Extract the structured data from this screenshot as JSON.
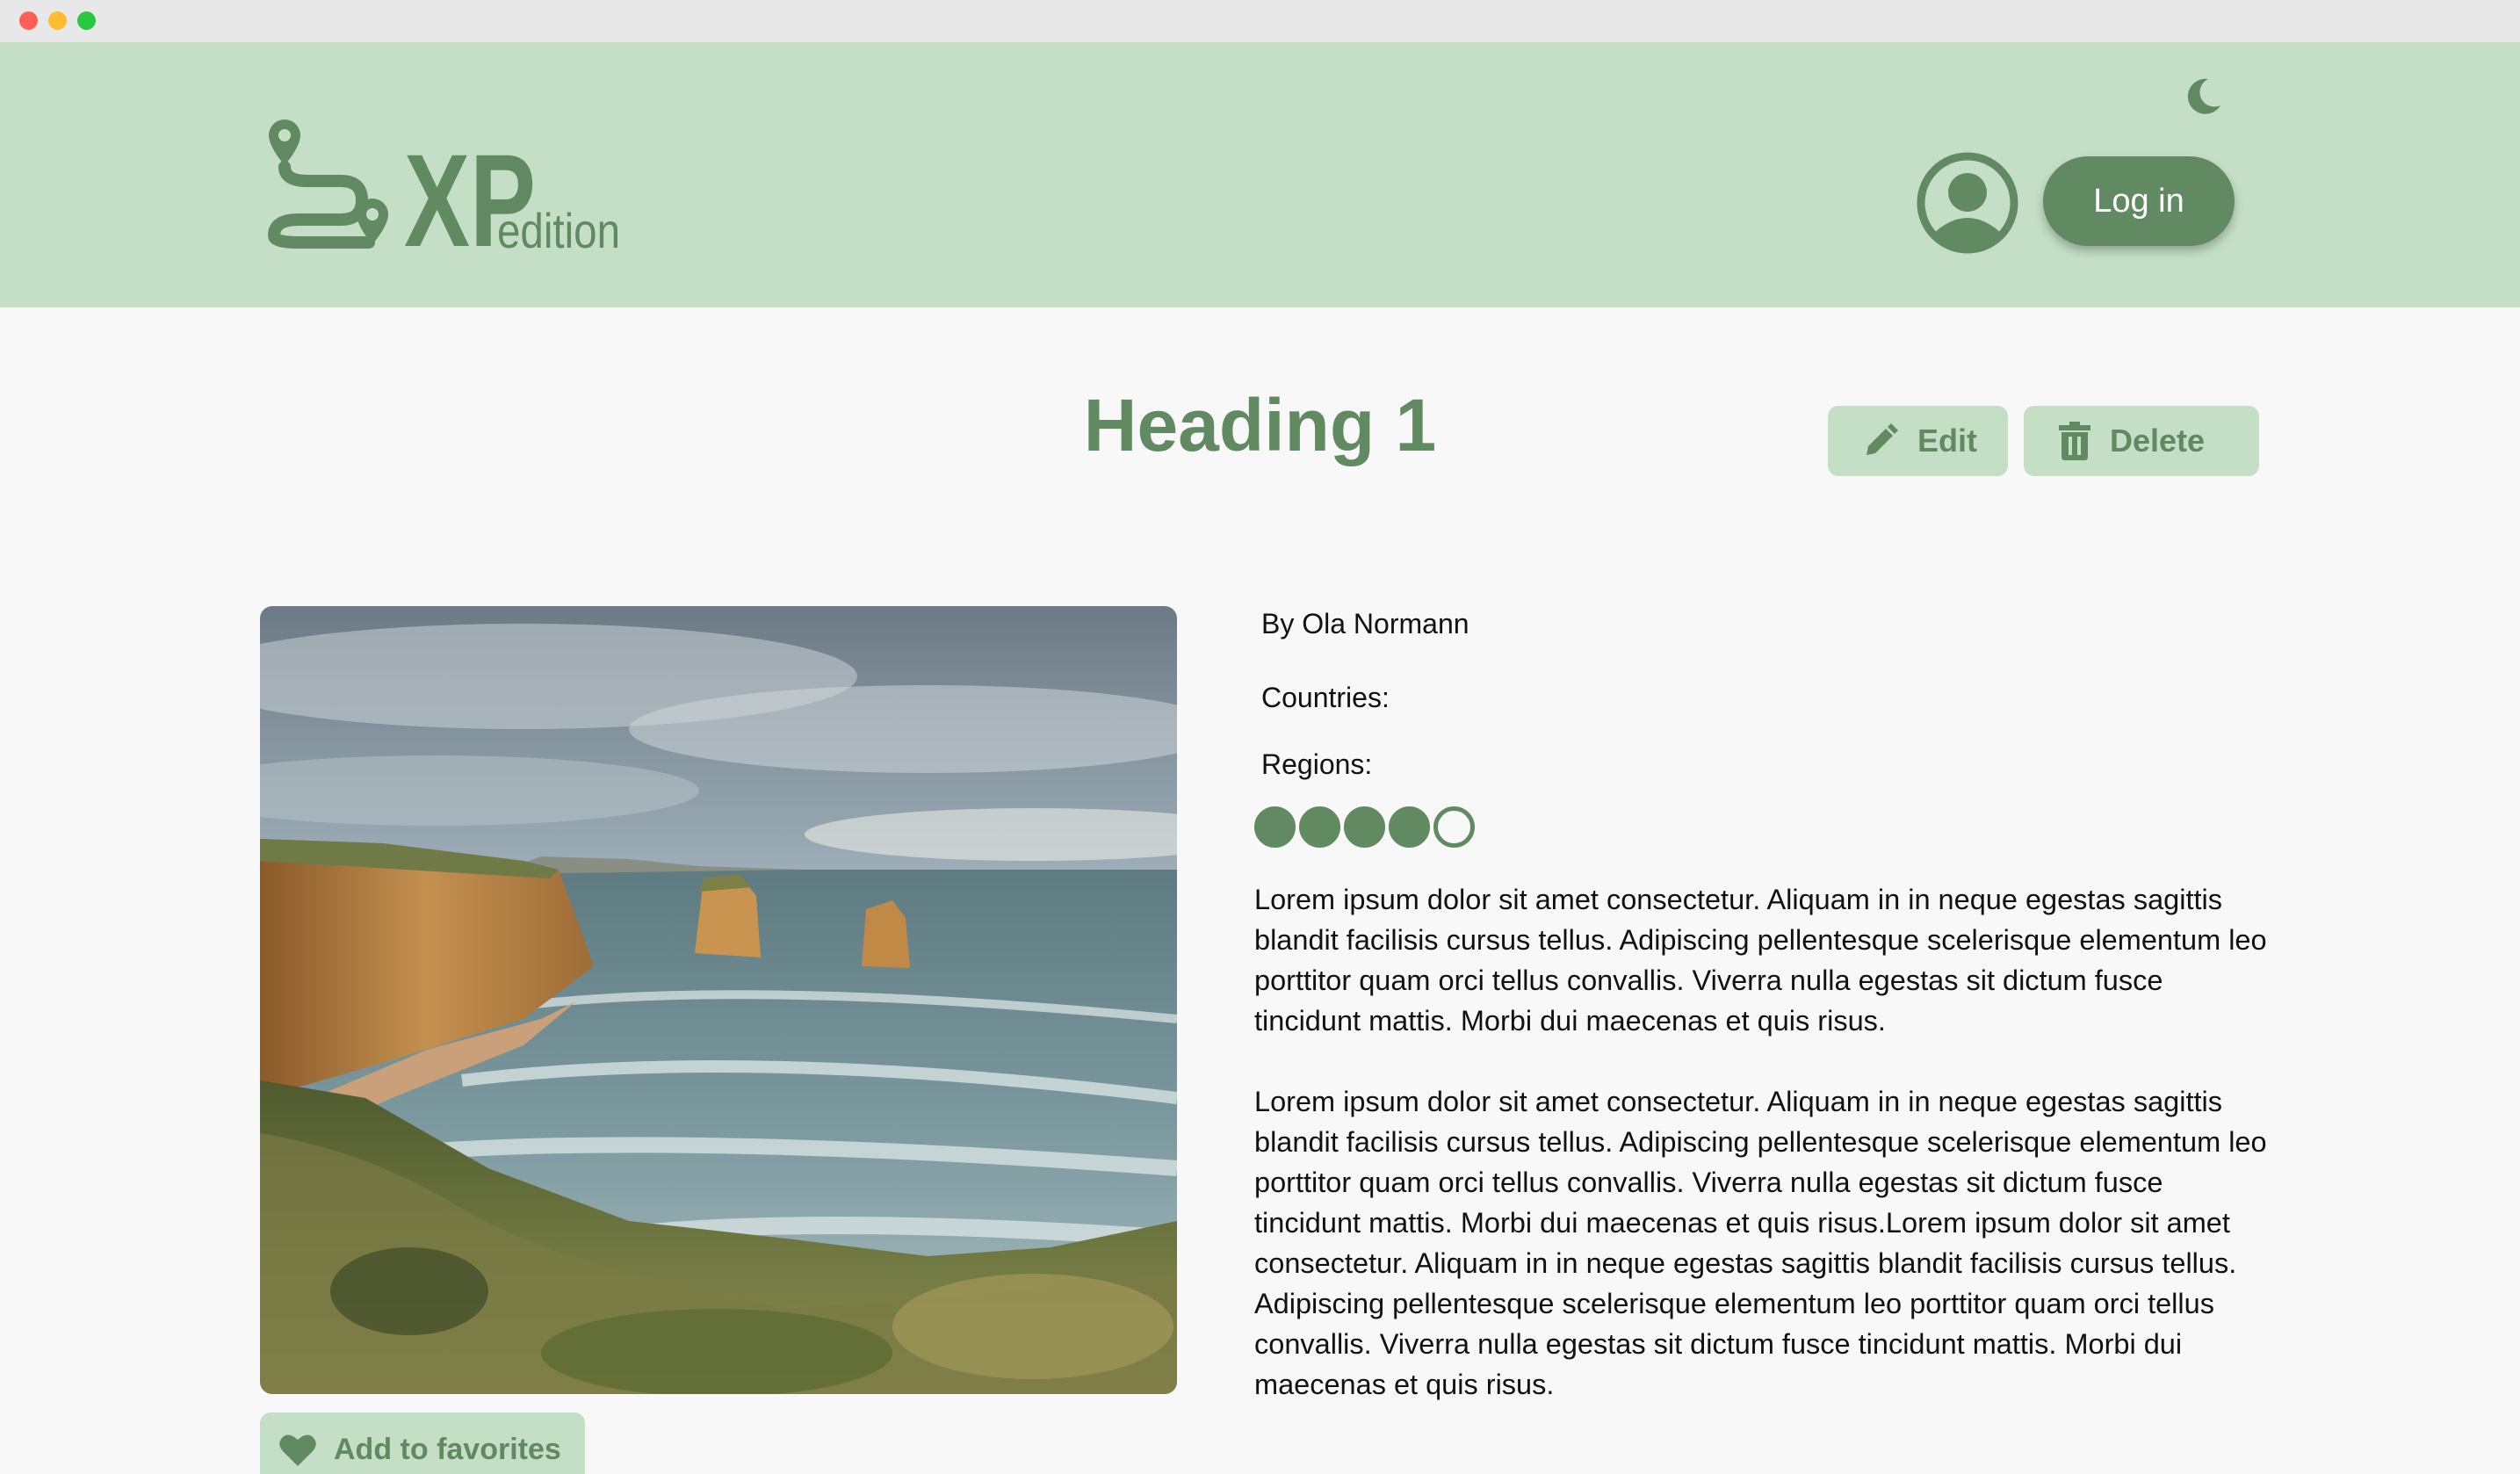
{
  "window": {
    "controls": [
      "close",
      "minimize",
      "zoom"
    ]
  },
  "header": {
    "logo": {
      "main": "XP",
      "sub": "edition"
    },
    "theme_toggle_icon": "moon-icon",
    "profile_icon": "user-circle-icon",
    "login_label": "Log in"
  },
  "page": {
    "title": "Heading 1",
    "edit_label": "Edit",
    "delete_label": "Delete"
  },
  "trip": {
    "author": "By Ola Normann",
    "countries_label": "Countries:",
    "regions_label": "Regions:",
    "rating": {
      "value": 4,
      "max": 5
    },
    "paragraphs": [
      "Lorem ipsum dolor sit amet consectetur. Aliquam in in neque egestas sagittis blandit facilisis cursus tellus. Adipiscing pellentesque scelerisque elementum leo porttitor quam orci tellus convallis. Viverra nulla egestas sit dictum fusce tincidunt mattis. Morbi dui maecenas et quis risus.",
      "Lorem ipsum dolor sit amet consectetur. Aliquam in in neque egestas sagittis blandit facilisis cursus tellus. Adipiscing pellentesque scelerisque elementum leo porttitor quam orci tellus convallis. Viverra nulla egestas sit dictum fusce tincidunt mattis. Morbi dui maecenas et quis risus.Lorem ipsum dolor sit amet consectetur. Aliquam in in neque egestas sagittis blandit facilisis cursus tellus. Adipiscing pellentesque scelerisque elementum leo porttitor quam orci tellus convallis. Viverra nulla egestas sit dictum fusce tincidunt mattis. Morbi dui maecenas et quis risus."
    ],
    "favorite_label": "Add to favorites"
  },
  "colors": {
    "header_bg": "#c4dfc5",
    "accent": "#628a62",
    "page_bg": "#f8f8f8"
  }
}
